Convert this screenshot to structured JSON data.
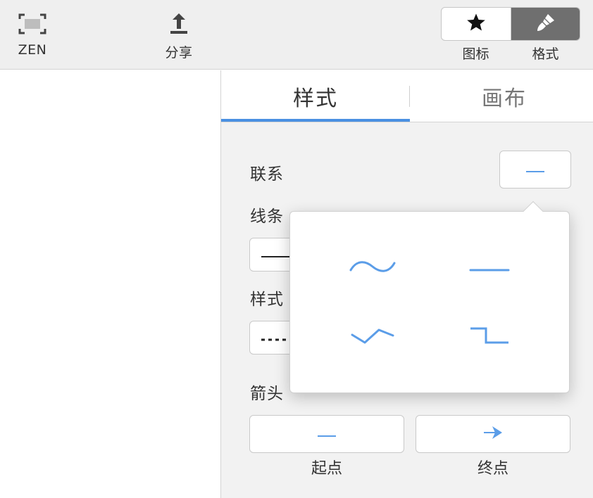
{
  "toolbar": {
    "zen_label": "ZEN",
    "share_label": "分享",
    "icon_label": "图标",
    "format_label": "格式",
    "zen_icon": "focus-frame-icon",
    "share_icon": "share-upload-icon",
    "icon_tab_icon": "star-icon",
    "format_tab_icon": "paintbrush-icon",
    "active_segment": "格式"
  },
  "inspector": {
    "tabs": [
      {
        "label": "样式",
        "active": true
      },
      {
        "label": "画布",
        "active": false
      }
    ],
    "relation_label": "联系",
    "line_label": "线条",
    "style_label": "样式",
    "arrow_label": "箭头",
    "arrow_start_label": "起点",
    "arrow_end_label": "终点",
    "relation_value_icon": "straight-line-icon",
    "arrow_start_icon": "straight-line-icon",
    "arrow_end_icon": "arrow-right-icon"
  },
  "popover": {
    "options": [
      {
        "icon": "curved-line-icon"
      },
      {
        "icon": "straight-line-icon"
      },
      {
        "icon": "angled-line-icon"
      },
      {
        "icon": "elbow-line-icon"
      }
    ]
  },
  "colors": {
    "accent": "#4a90e2",
    "line_blue": "#5b9de8",
    "toolbar_bg": "#efefef",
    "inspector_bg": "#f2f2f2",
    "segment_active": "#6f6f6f"
  }
}
